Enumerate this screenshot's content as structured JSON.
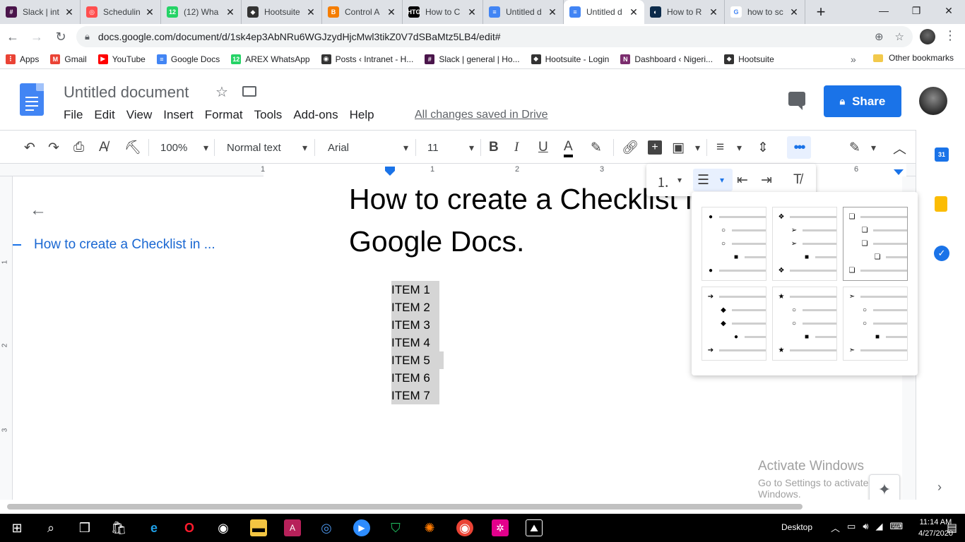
{
  "browser": {
    "tabs": [
      {
        "label": "Slack | int",
        "color": "#4a154b",
        "glyph": "#"
      },
      {
        "label": "Schedulin",
        "color": "#ff4f4f",
        "glyph": "◎"
      },
      {
        "label": "(12) Wha",
        "color": "#25d366",
        "glyph": "12"
      },
      {
        "label": "Hootsuite",
        "color": "#333333",
        "glyph": "◆"
      },
      {
        "label": "Control A",
        "color": "#f57d00",
        "glyph": "B"
      },
      {
        "label": "How to C",
        "color": "#000000",
        "glyph": "HTG"
      },
      {
        "label": "Untitled d",
        "color": "#4285f4",
        "glyph": "≡"
      },
      {
        "label": "Untitled d",
        "color": "#4285f4",
        "glyph": "≡",
        "active": true
      },
      {
        "label": "How to R",
        "color": "#0b2a4a",
        "glyph": "◐"
      },
      {
        "label": "how to sc",
        "color": "#ffffff",
        "glyph": "G"
      }
    ],
    "url": "docs.google.com/document/d/1sk4ep3AbNRu6WGJzydHjcMwl3tikZ0V7dSBaMtz5LB4/edit#",
    "bookmarks": [
      {
        "label": "Apps",
        "color": "#ea4335",
        "glyph": "⋮"
      },
      {
        "label": "Gmail",
        "color": "#ea4335",
        "glyph": "M"
      },
      {
        "label": "YouTube",
        "color": "#ff0000",
        "glyph": "▶"
      },
      {
        "label": "Google Docs",
        "color": "#4285f4",
        "glyph": "≡"
      },
      {
        "label": "AREX WhatsApp",
        "color": "#25d366",
        "glyph": "12"
      },
      {
        "label": "Posts ‹ Intranet - H...",
        "color": "#333333",
        "glyph": "◉"
      },
      {
        "label": "Slack | general | Ho...",
        "color": "#4a154b",
        "glyph": "#"
      },
      {
        "label": "Hootsuite - Login",
        "color": "#333333",
        "glyph": "◆"
      },
      {
        "label": "Dashboard ‹ Nigeri...",
        "color": "#7b2d6e",
        "glyph": "N"
      },
      {
        "label": "Hootsuite",
        "color": "#333333",
        "glyph": "◆"
      }
    ],
    "bookmarks_more": "»",
    "other_bookmarks": "Other bookmarks"
  },
  "docs": {
    "title": "Untitled document",
    "menu": [
      "File",
      "Edit",
      "View",
      "Insert",
      "Format",
      "Tools",
      "Add-ons",
      "Help"
    ],
    "save_status": "All changes saved in Drive",
    "share_label": "Share",
    "toolbar": {
      "zoom": "100%",
      "style": "Normal text",
      "font": "Arial",
      "size": "11"
    },
    "ruler_numbers": [
      "1",
      "1",
      "2",
      "3",
      "6"
    ],
    "vruler_numbers": [
      "1",
      "2",
      "3"
    ],
    "outline_item": "How to create a Checklist in ...",
    "heading": "How to create a Checklist in Google Docs.",
    "items": [
      "ITEM 1",
      "ITEM 2",
      "ITEM 3",
      "ITEM 4",
      "ITEM 5",
      "ITEM 6",
      "ITEM 7"
    ],
    "bullet_gallery": [
      [
        "●",
        "○",
        "○",
        "■",
        "●"
      ],
      [
        "❖",
        "➢",
        "➢",
        "■",
        "❖"
      ],
      [
        "❏",
        "❏",
        "❏",
        "❏",
        "❏"
      ],
      [
        "➔",
        "◆",
        "◆",
        "●",
        "➔"
      ],
      [
        "★",
        "○",
        "○",
        "■",
        "★"
      ],
      [
        "➣",
        "○",
        "○",
        "■",
        "➣"
      ]
    ]
  },
  "windows": {
    "activate_title": "Activate Windows",
    "activate_sub": "Go to Settings to activate Windows.",
    "desktop_label": "Desktop",
    "time": "11:14 AM",
    "date": "4/27/2020"
  }
}
